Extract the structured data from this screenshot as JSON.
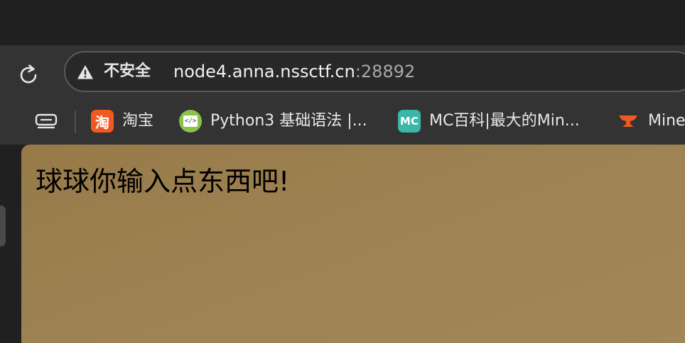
{
  "toolbar": {
    "security_label": "不安全",
    "url_host": "node4.anna.nssctf.cn",
    "url_port": ":28892"
  },
  "bookmarks": [
    {
      "label": "淘宝",
      "icon": "taobao-icon",
      "icon_text": "淘",
      "color": "#f05a22"
    },
    {
      "label": "Python3 基础语法 |...",
      "icon": "runoob-code-icon",
      "icon_text": "</>",
      "color": "#8bc34a"
    },
    {
      "label": "MC百科|最大的Min...",
      "icon": "mcmod-icon",
      "icon_text": "MC",
      "color": "#3cb6a8"
    },
    {
      "label": "Mine",
      "icon": "anvil-icon",
      "color": "#f05a22"
    }
  ],
  "page": {
    "message": "球球你输入点东西吧!"
  },
  "colors": {
    "toolbar_bg": "#333333",
    "page_bg": "#9d8253"
  }
}
